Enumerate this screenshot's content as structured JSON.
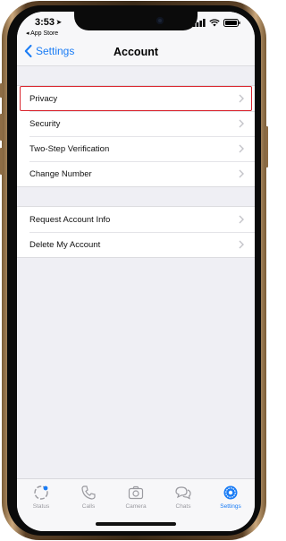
{
  "status": {
    "time": "3:53",
    "back_app": "◂ App Store"
  },
  "nav": {
    "back_label": "Settings",
    "title": "Account"
  },
  "groups": [
    {
      "items": [
        {
          "label": "Privacy"
        },
        {
          "label": "Security"
        },
        {
          "label": "Two-Step Verification"
        },
        {
          "label": "Change Number"
        }
      ]
    },
    {
      "items": [
        {
          "label": "Request Account Info"
        },
        {
          "label": "Delete My Account"
        }
      ]
    }
  ],
  "tabs": [
    {
      "label": "Status",
      "icon": "status-icon"
    },
    {
      "label": "Calls",
      "icon": "phone-icon"
    },
    {
      "label": "Camera",
      "icon": "camera-icon"
    },
    {
      "label": "Chats",
      "icon": "chat-bubbles-icon"
    },
    {
      "label": "Settings",
      "icon": "gear-icon"
    }
  ],
  "colors": {
    "accent": "#1a7cf5",
    "highlight_border": "#d9252e",
    "background": "#efeff4"
  }
}
